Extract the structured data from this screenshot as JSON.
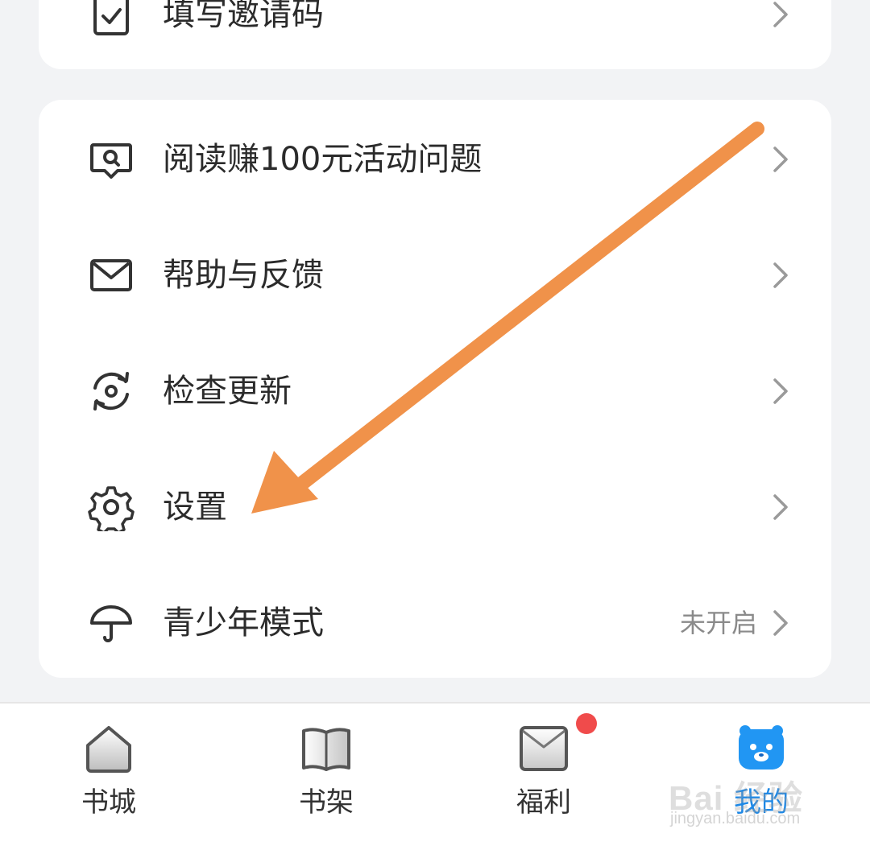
{
  "menu_top": {
    "invite": {
      "label": "填写邀请码",
      "icon": "clipboard-check-icon"
    }
  },
  "menu": {
    "items": [
      {
        "label": "阅读赚100元活动问题",
        "icon": "search-chat-icon",
        "value": ""
      },
      {
        "label": "帮助与反馈",
        "icon": "mail-icon",
        "value": ""
      },
      {
        "label": "检查更新",
        "icon": "refresh-icon",
        "value": ""
      },
      {
        "label": "设置",
        "icon": "gear-icon",
        "value": ""
      },
      {
        "label": "青少年模式",
        "icon": "umbrella-icon",
        "value": "未开启"
      }
    ]
  },
  "tabbar": {
    "tabs": [
      {
        "label": "书城",
        "icon": "home-icon",
        "active": false
      },
      {
        "label": "书架",
        "icon": "book-icon",
        "active": false
      },
      {
        "label": "福利",
        "icon": "envelope-icon",
        "active": false,
        "badge": true
      },
      {
        "label": "我的",
        "icon": "bear-icon",
        "active": true
      }
    ]
  },
  "watermark": {
    "brand": "Bai 经验",
    "url": "jingyan.baidu.com"
  },
  "colors": {
    "background": "#f2f3f5",
    "card": "#ffffff",
    "text": "#2b2b2b",
    "muted": "#8a8a8a",
    "active_tab": "#1e88e5",
    "badge": "#f04b4b",
    "annotation_arrow": "#f0924a"
  }
}
